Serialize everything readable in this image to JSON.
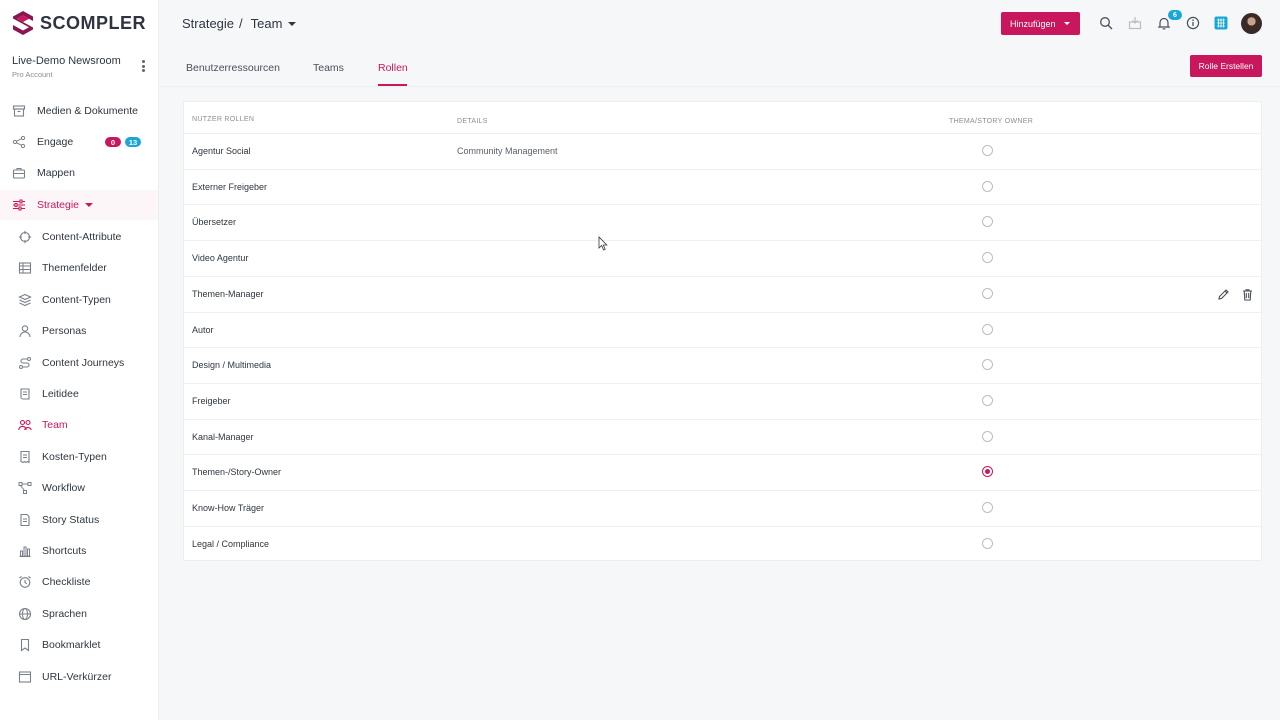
{
  "brand": {
    "name": "SCOMPLER",
    "accent": "#c8175d",
    "info": "#1ba6d9"
  },
  "account": {
    "name": "Live-Demo Newsroom",
    "type": "Pro Account"
  },
  "sidebar": {
    "top_items": [
      {
        "label": "Medien & Dokumente",
        "icon": "archive-icon"
      },
      {
        "label": "Engage",
        "icon": "share-icon",
        "badges": [
          "0",
          "13"
        ]
      },
      {
        "label": "Mappen",
        "icon": "briefcase-icon"
      }
    ],
    "section": {
      "label": "Strategie",
      "icon": "sliders-icon"
    },
    "sub_items": [
      {
        "label": "Content-Attribute",
        "icon": "crosshair-icon"
      },
      {
        "label": "Themenfelder",
        "icon": "table-icon"
      },
      {
        "label": "Content-Typen",
        "icon": "layers-icon"
      },
      {
        "label": "Personas",
        "icon": "user-icon"
      },
      {
        "label": "Content Journeys",
        "icon": "route-icon"
      },
      {
        "label": "Leitidee",
        "icon": "scroll-icon"
      },
      {
        "label": "Team",
        "icon": "users-icon",
        "active": true
      },
      {
        "label": "Kosten-Typen",
        "icon": "receipt-icon"
      },
      {
        "label": "Workflow",
        "icon": "workflow-icon"
      },
      {
        "label": "Story Status",
        "icon": "document-icon"
      },
      {
        "label": "Shortcuts",
        "icon": "bar-chart-icon"
      },
      {
        "label": "Checkliste",
        "icon": "alarm-clock-icon"
      },
      {
        "label": "Sprachen",
        "icon": "globe-icon"
      },
      {
        "label": "Bookmarklet",
        "icon": "bookmark-icon"
      },
      {
        "label": "URL-Verkürzer",
        "icon": "window-icon"
      }
    ]
  },
  "header": {
    "breadcrumb": {
      "parent": "Strategie",
      "separator": "/",
      "current": "Team"
    },
    "add_button": "Hinzufügen",
    "notification_count": "6"
  },
  "tabs": [
    {
      "label": "Benutzerressourcen",
      "active": false
    },
    {
      "label": "Teams",
      "active": false
    },
    {
      "label": "Rollen",
      "active": true
    }
  ],
  "create_button": "Rolle Erstellen",
  "table": {
    "columns": [
      "NUTZER ROLLEN",
      "DETAILS",
      "THEMA/STORY OWNER"
    ],
    "rows": [
      {
        "name": "Agentur Social",
        "details": "Community Management",
        "owner": false
      },
      {
        "name": "Externer Freigeber",
        "details": "",
        "owner": false
      },
      {
        "name": "Übersetzer",
        "details": "",
        "owner": false
      },
      {
        "name": "Video Agentur",
        "details": "",
        "owner": false
      },
      {
        "name": "Themen-Manager",
        "details": "",
        "owner": false,
        "hovered": true
      },
      {
        "name": "Autor",
        "details": "",
        "owner": false
      },
      {
        "name": "Design / Multimedia",
        "details": "",
        "owner": false
      },
      {
        "name": "Freigeber",
        "details": "",
        "owner": false
      },
      {
        "name": "Kanal-Manager",
        "details": "",
        "owner": false
      },
      {
        "name": "Themen-/Story-Owner",
        "details": "",
        "owner": true
      },
      {
        "name": "Know-How Träger",
        "details": "",
        "owner": false
      },
      {
        "name": "Legal / Compliance",
        "details": "",
        "owner": false
      }
    ]
  }
}
